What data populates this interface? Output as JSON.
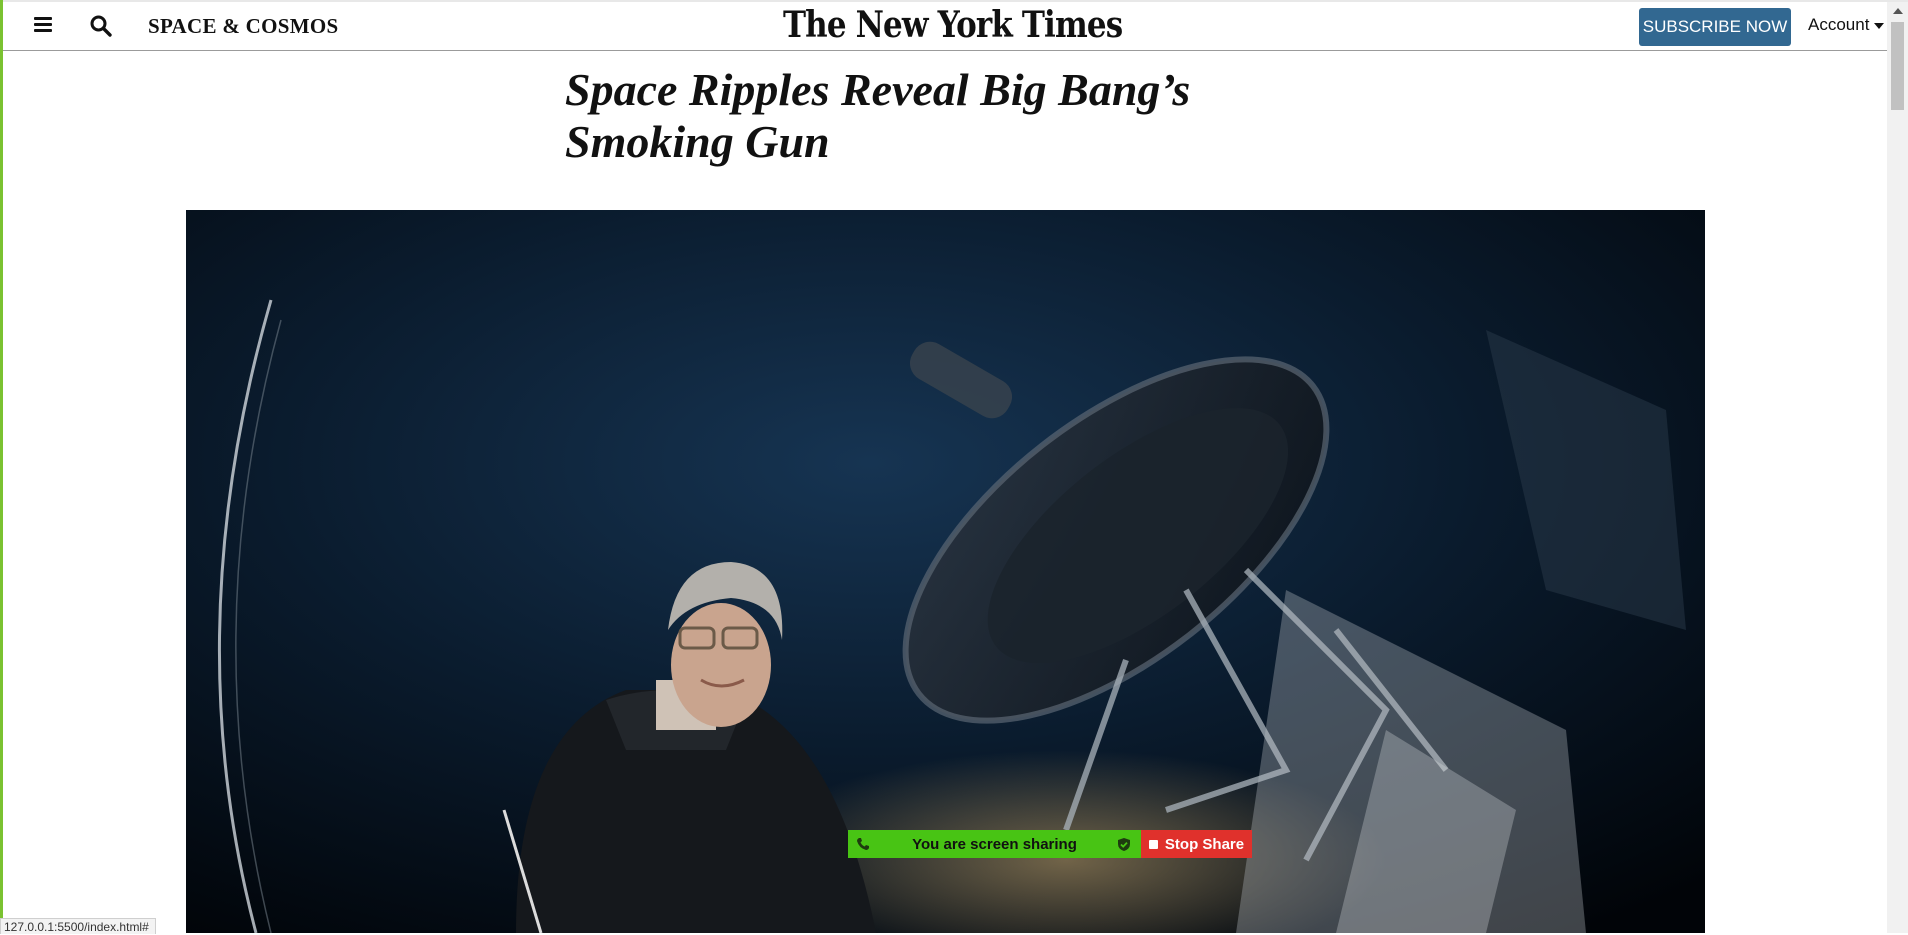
{
  "header": {
    "section": "SPACE & COSMOS",
    "masthead": "The New York Times",
    "subscribe_label": "SUBSCRIBE NOW",
    "account_label": "Account"
  },
  "article": {
    "headline": "Space Ripples Reveal Big Bang’s Smoking Gun"
  },
  "screen_share": {
    "status_text": "You are screen sharing",
    "stop_label": "Stop Share"
  },
  "status_bar": {
    "url": "127.0.0.1:5500/index.html#"
  },
  "icons": {
    "menu": "hamburger-menu-icon",
    "search": "search-icon",
    "caret": "caret-down-icon",
    "phone": "phone-icon",
    "shield": "shield-check-icon",
    "stop": "stop-square-icon"
  },
  "colors": {
    "subscribe_bg": "#326891",
    "share_green": "#48c414",
    "stop_red": "#e0312c",
    "frame_green": "#7ac231"
  }
}
